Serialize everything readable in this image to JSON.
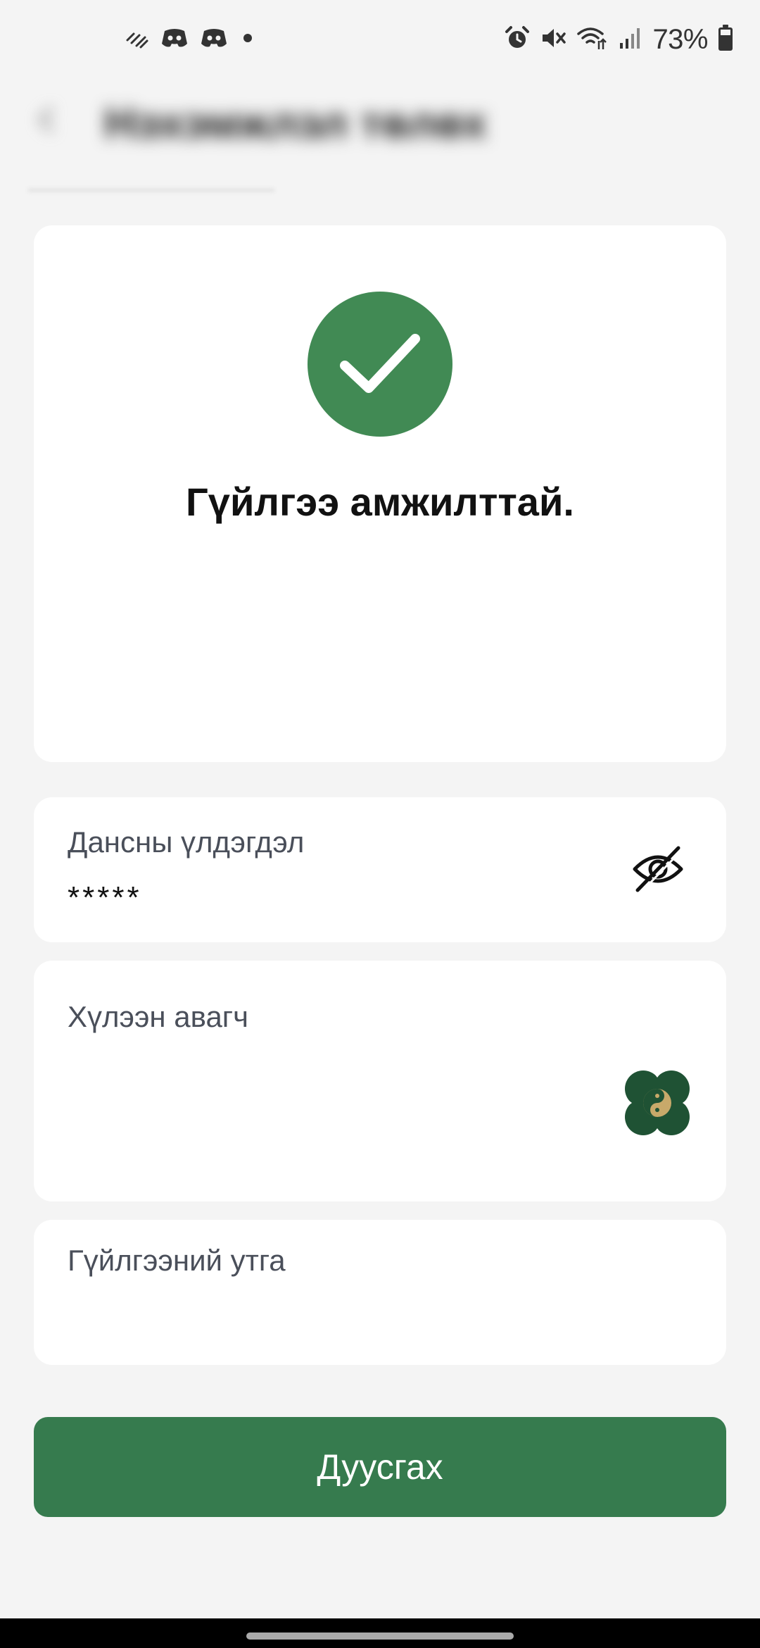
{
  "status_bar": {
    "battery_percent": "73%",
    "left_icons": [
      "weather-icon",
      "discord-icon",
      "discord-icon",
      "dot-icon"
    ],
    "right_icons": [
      "alarm-icon",
      "mute-icon",
      "wifi-icon",
      "signal-icon",
      "battery-icon"
    ]
  },
  "header": {
    "title": "Нэхэмжлэл төлөх"
  },
  "success": {
    "message": "Гүйлгээ амжилттай.",
    "icon": "checkmark-icon",
    "color": "#418a54"
  },
  "balance": {
    "label": "Дансны үлдэгдэл",
    "value": "*****",
    "toggle_icon": "eye-off-icon"
  },
  "recipient": {
    "label": "Хүлээн авагч",
    "logo_icon": "recipient-logo-icon"
  },
  "description": {
    "label": "Гүйлгээний утга"
  },
  "done_button": {
    "label": "Дуусгах",
    "color": "#367b4e"
  }
}
